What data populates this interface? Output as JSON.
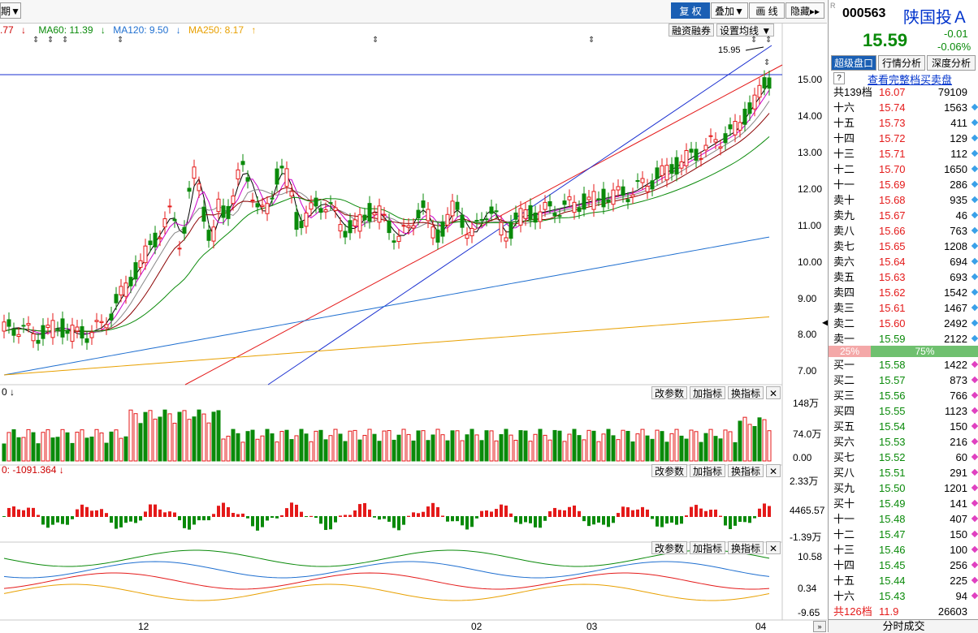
{
  "toolbar": {
    "period_label": "期",
    "fuquan": "复 权",
    "diejia": "叠加",
    "huaxian": "画 线",
    "yincang": "隐藏"
  },
  "ma_legend": {
    "first": ".77",
    "ma60": "MA60: 11.39",
    "ma120": "MA120: 9.50",
    "ma250": "MA250: 8.17"
  },
  "chart_buttons": {
    "margin": "融资融券",
    "set_ma": "设置均线"
  },
  "peak_label": "15.95",
  "price_axis": [
    "15.00",
    "14.00",
    "13.00",
    "12.00",
    "11.00",
    "10.00",
    "9.00",
    "8.00",
    "7.00"
  ],
  "panel_buttons": {
    "gaicanshu": "改参数",
    "jiazhibiao": "加指标",
    "huanzhibiao": "换指标",
    "close": "✕"
  },
  "volume_axis": [
    "148万",
    "74.0万",
    "0.00"
  ],
  "macd_label": "0: -1091.364",
  "macd_axis": [
    "2.33万",
    "4465.57",
    "-1.39万"
  ],
  "third_axis": [
    "10.58",
    "0.34",
    "-9.65"
  ],
  "x_axis": [
    "12",
    "02",
    "03",
    "04"
  ],
  "side": {
    "code": "000563",
    "name": "陕国投Ａ",
    "price": "15.59",
    "change": "-0.01",
    "change_pct": "-0.06%",
    "tabs": [
      "超级盘口",
      "行情分析",
      "深度分析"
    ],
    "view_full": "查看完整档买卖盘",
    "question": "?",
    "sell_total_label": "共139档",
    "sell_total_price": "16.07",
    "sell_total_vol": "79109",
    "sell": [
      {
        "label": "十六",
        "price": "15.74",
        "vol": "1563"
      },
      {
        "label": "十五",
        "price": "15.73",
        "vol": "411"
      },
      {
        "label": "十四",
        "price": "15.72",
        "vol": "129"
      },
      {
        "label": "十三",
        "price": "15.71",
        "vol": "112"
      },
      {
        "label": "十二",
        "price": "15.70",
        "vol": "1650"
      },
      {
        "label": "十一",
        "price": "15.69",
        "vol": "286"
      },
      {
        "label": "卖十",
        "price": "15.68",
        "vol": "935"
      },
      {
        "label": "卖九",
        "price": "15.67",
        "vol": "46"
      },
      {
        "label": "卖八",
        "price": "15.66",
        "vol": "763"
      },
      {
        "label": "卖七",
        "price": "15.65",
        "vol": "1208"
      },
      {
        "label": "卖六",
        "price": "15.64",
        "vol": "694"
      },
      {
        "label": "卖五",
        "price": "15.63",
        "vol": "693"
      },
      {
        "label": "卖四",
        "price": "15.62",
        "vol": "1542"
      },
      {
        "label": "卖三",
        "price": "15.61",
        "vol": "1467"
      },
      {
        "label": "卖二",
        "price": "15.60",
        "vol": "2492"
      },
      {
        "label": "卖一",
        "price": "15.59",
        "vol": "2122"
      }
    ],
    "ratio_sell": "25%",
    "ratio_buy": "75%",
    "buy": [
      {
        "label": "买一",
        "price": "15.58",
        "vol": "1422"
      },
      {
        "label": "买二",
        "price": "15.57",
        "vol": "873"
      },
      {
        "label": "买三",
        "price": "15.56",
        "vol": "766"
      },
      {
        "label": "买四",
        "price": "15.55",
        "vol": "1123"
      },
      {
        "label": "买五",
        "price": "15.54",
        "vol": "150"
      },
      {
        "label": "买六",
        "price": "15.53",
        "vol": "216"
      },
      {
        "label": "买七",
        "price": "15.52",
        "vol": "60"
      },
      {
        "label": "买八",
        "price": "15.51",
        "vol": "291"
      },
      {
        "label": "买九",
        "price": "15.50",
        "vol": "1201"
      },
      {
        "label": "买十",
        "price": "15.49",
        "vol": "141"
      },
      {
        "label": "十一",
        "price": "15.48",
        "vol": "407"
      },
      {
        "label": "十二",
        "price": "15.47",
        "vol": "150"
      },
      {
        "label": "十三",
        "price": "15.46",
        "vol": "100"
      },
      {
        "label": "十四",
        "price": "15.45",
        "vol": "256"
      },
      {
        "label": "十五",
        "price": "15.44",
        "vol": "225"
      },
      {
        "label": "十六",
        "price": "15.43",
        "vol": "94"
      }
    ],
    "buy_total_label": "共126档",
    "buy_total_price": "11.9",
    "buy_total_vol": "26603",
    "bottom_tab": "分时成交"
  },
  "colors": {
    "up": "#e41a1a",
    "down": "#0a8a0a",
    "accent": "#1a5fb4",
    "ma5": "#000000",
    "ma10": "#cc00cc",
    "ma20": "#888888",
    "ma30": "#8b0000",
    "ma60": "#0a8a0a",
    "ma120": "#1f6fd0",
    "ma250": "#e8a000"
  }
}
